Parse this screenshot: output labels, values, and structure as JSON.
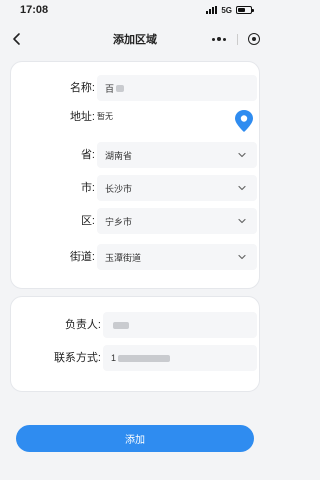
{
  "status_bar": {
    "time": "17:08",
    "network": "5G"
  },
  "nav": {
    "title": "添加区域"
  },
  "form": {
    "name": {
      "label": "名称:",
      "value": "百"
    },
    "address": {
      "label": "地址:",
      "value": "暂无"
    },
    "province": {
      "label": "省:",
      "value": "湖南省"
    },
    "city": {
      "label": "市:",
      "value": "长沙市"
    },
    "district": {
      "label": "区:",
      "value": "宁乡市"
    },
    "street": {
      "label": "街道:",
      "value": "玉潭街道"
    }
  },
  "contact": {
    "person": {
      "label": "负责人:",
      "value": ""
    },
    "phone": {
      "label": "联系方式:",
      "value": "1"
    }
  },
  "submit_label": "添加",
  "colors": {
    "accent": "#2f8cf0",
    "background": "#f3f4f6"
  }
}
